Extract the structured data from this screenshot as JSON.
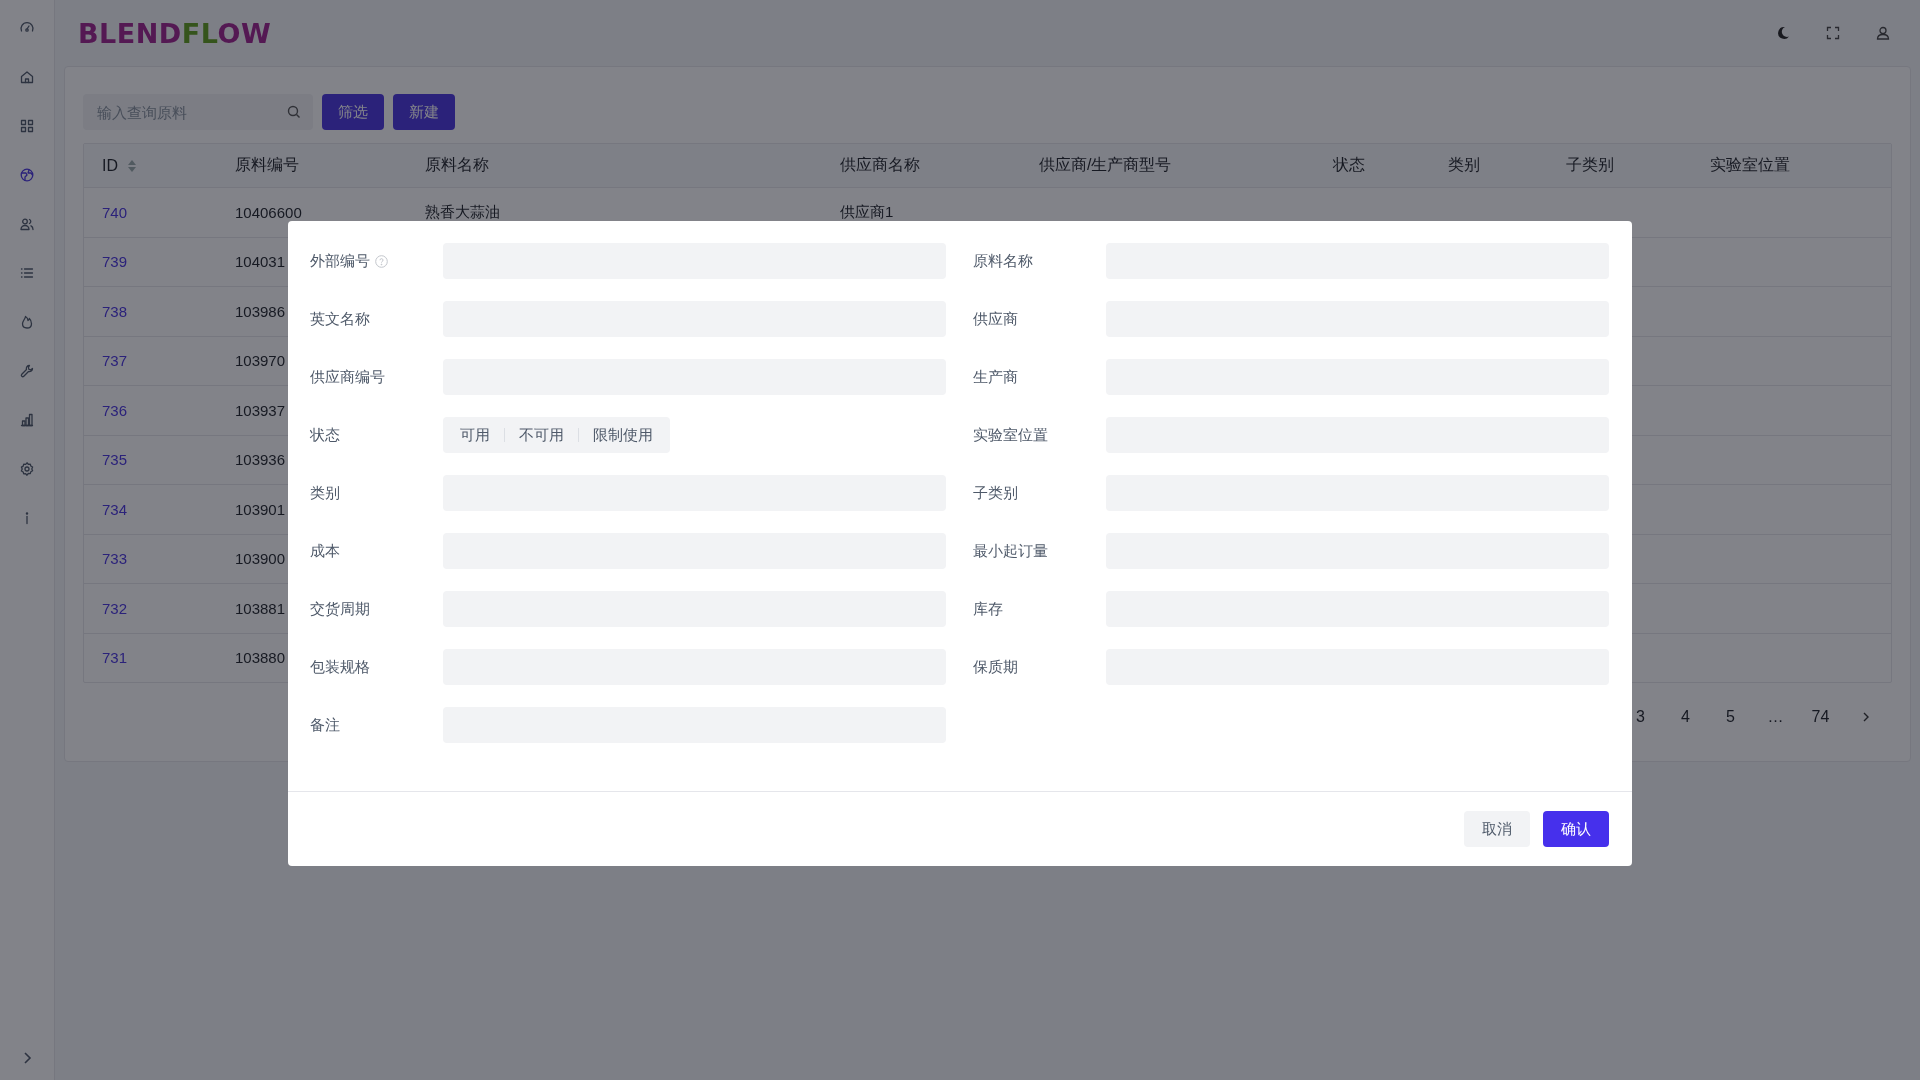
{
  "logo": [
    "BLEND",
    "FL",
    "OW"
  ],
  "sidebar": {
    "items": [
      {
        "selected": false
      },
      {
        "selected": false
      },
      {
        "selected": false
      },
      {
        "selected": true
      },
      {
        "selected": false
      },
      {
        "selected": false
      },
      {
        "selected": false
      },
      {
        "selected": false
      },
      {
        "selected": false
      },
      {
        "selected": false
      },
      {
        "selected": false
      }
    ]
  },
  "toolbar": {
    "search": {
      "placeholder": "输入查询原料"
    },
    "buttons": [
      "筛选",
      "新建"
    ]
  },
  "table": {
    "columns": [
      "ID",
      "原料编号",
      "原料名称",
      "供应商名称",
      "供应商/生产商型号",
      "状态",
      "类别",
      "子类别",
      "实验室位置"
    ],
    "rows": [
      [
        "740",
        "10406600",
        "熟香大蒜油",
        "供应商1"
      ],
      [
        "739",
        "104031"
      ],
      [
        "738",
        "103986"
      ],
      [
        "737",
        "103970"
      ],
      [
        "736",
        "103937"
      ],
      [
        "735",
        "103936"
      ],
      [
        "734",
        "103901"
      ],
      [
        "733",
        "103900"
      ],
      [
        "732",
        "103881"
      ],
      [
        "731",
        "103880"
      ]
    ]
  },
  "pagination": {
    "pages": [
      "3",
      "4",
      "5",
      "…",
      "74"
    ]
  },
  "dialog": {
    "fields": [
      {
        "label": "外部编号",
        "kind": "text",
        "help": true
      },
      {
        "label": "原料名称",
        "kind": "text",
        "help": false
      },
      {
        "label": "英文名称",
        "kind": "text",
        "help": false
      },
      {
        "label": "供应商",
        "kind": "text",
        "help": false
      },
      {
        "label": "供应商编号",
        "kind": "text",
        "help": false
      },
      {
        "label": "生产商",
        "kind": "text",
        "help": false
      },
      {
        "label": "状态",
        "kind": "segmented",
        "help": false,
        "options": [
          {
            "label": "可用",
            "selected": false
          },
          {
            "label": "不可用",
            "selected": false
          },
          {
            "label": "限制使用",
            "selected": false
          }
        ]
      },
      {
        "label": "实验室位置",
        "kind": "text",
        "help": false
      },
      {
        "label": "类别",
        "kind": "text",
        "help": false
      },
      {
        "label": "子类别",
        "kind": "text",
        "help": false
      },
      {
        "label": "成本",
        "kind": "text",
        "help": false
      },
      {
        "label": "最小起订量",
        "kind": "text",
        "help": false
      },
      {
        "label": "交货周期",
        "kind": "text",
        "help": false
      },
      {
        "label": "库存",
        "kind": "text",
        "help": false
      },
      {
        "label": "包装规格",
        "kind": "text",
        "help": false
      },
      {
        "label": "保质期",
        "kind": "text",
        "help": false
      },
      {
        "label": "备注",
        "kind": "text",
        "help": false
      }
    ],
    "buttons": [
      "取消",
      "确认"
    ]
  }
}
